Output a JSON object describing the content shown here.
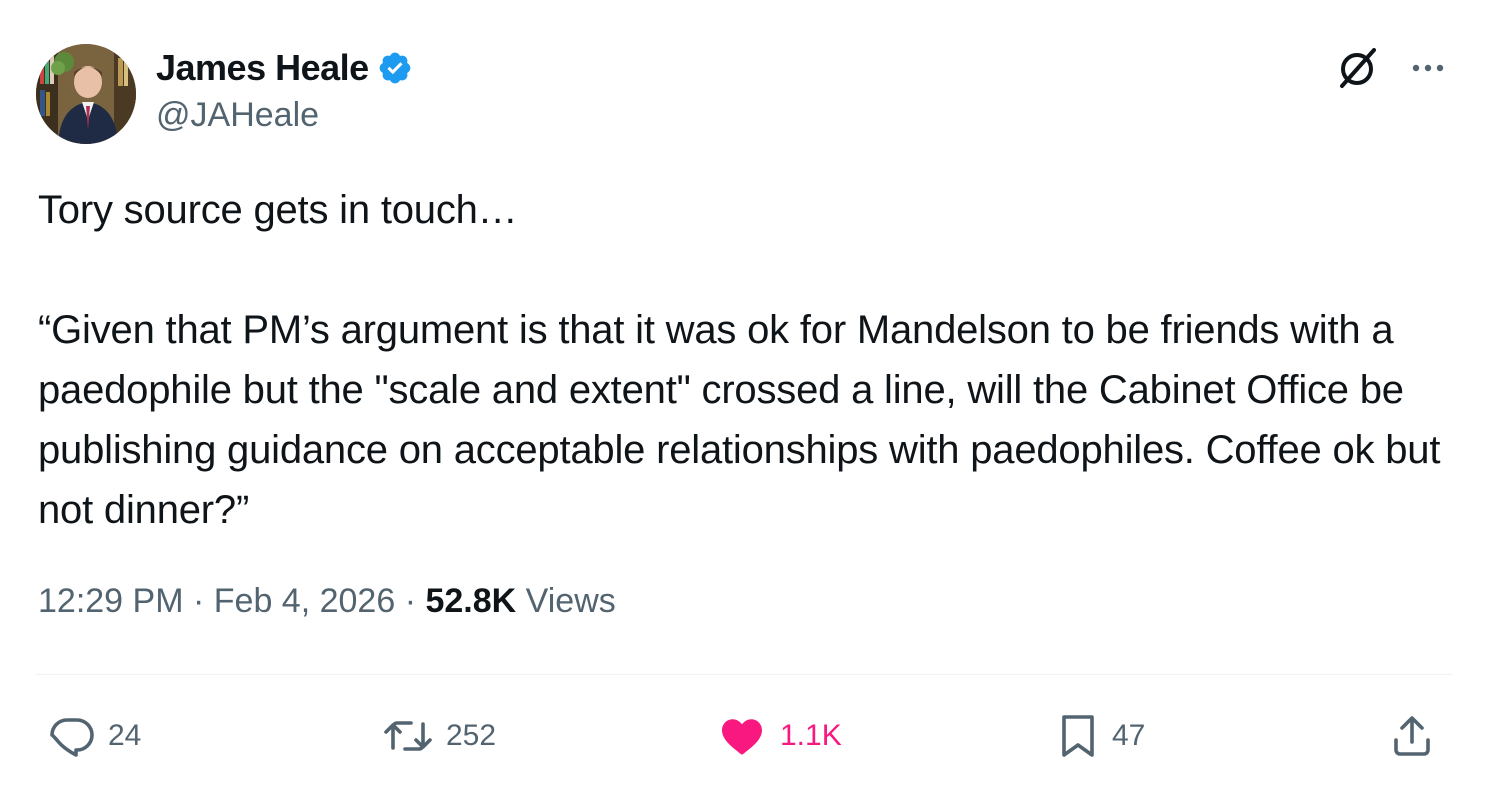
{
  "author": {
    "display_name": "James Heale",
    "handle": "@JAHeale",
    "verified": true
  },
  "tweet": {
    "text": "Tory source gets in touch…\n\n“Given that PM’s argument is that it was ok for Mandelson to be friends with a paedophile but the \"scale and extent\" crossed a line, will the Cabinet Office be publishing guidance on acceptable relationships with paedophiles. Coffee ok but not dinner?”",
    "time": "12:29 PM",
    "separator": "·",
    "date": "Feb 4, 2026",
    "views_count": "52.8K",
    "views_label": "Views"
  },
  "actions": {
    "replies": "24",
    "reposts": "252",
    "likes": "1.1K",
    "bookmarks": "47"
  },
  "icons": {
    "grok": "grok-icon",
    "more": "more-horizontal-icon",
    "reply": "reply-icon",
    "repost": "repost-icon",
    "like": "heart-icon",
    "bookmark": "bookmark-icon",
    "share": "share-icon",
    "verified": "verified-badge-icon"
  },
  "colors": {
    "text_primary": "#0f1419",
    "text_secondary": "#536471",
    "verified_blue": "#1d9bf0",
    "like_pink": "#f91880",
    "divider": "#eff3f4"
  }
}
